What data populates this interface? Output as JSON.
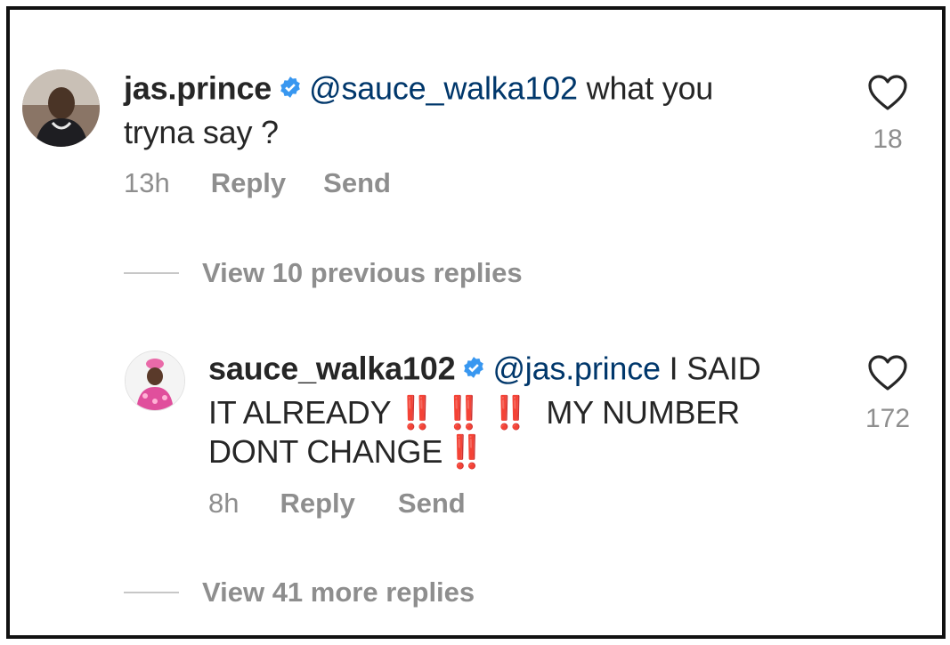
{
  "comments": [
    {
      "username": "jas.prince",
      "mention": "@sauce_walka102",
      "text_line1": " what you",
      "text_line2": "tryna say ?",
      "time": "13h",
      "reply_label": "Reply",
      "send_label": "Send",
      "like_count": "18"
    },
    {
      "username": "sauce_walka102",
      "mention": "@jas.prince",
      "text_line1": " I SAID",
      "text_line2_a": "IT ALREADY",
      "bang1": "‼️",
      "bang2": "‼️",
      "bang3": "‼️",
      "text_line2_b": " MY NUMBER",
      "text_line3": "DONT CHANGE",
      "bang4": "‼️",
      "time": "8h",
      "reply_label": "Reply",
      "send_label": "Send",
      "like_count": "172"
    }
  ],
  "view_previous": "View 10 previous replies",
  "view_more": "View 41 more replies",
  "icons": {
    "verified": "verified-badge-icon",
    "like": "heart-outline-icon"
  },
  "colors": {
    "username": "#262626",
    "mention": "#00376b",
    "meta": "#8e8e8e",
    "verified": "#3897f0",
    "bang": "#e0141e"
  }
}
